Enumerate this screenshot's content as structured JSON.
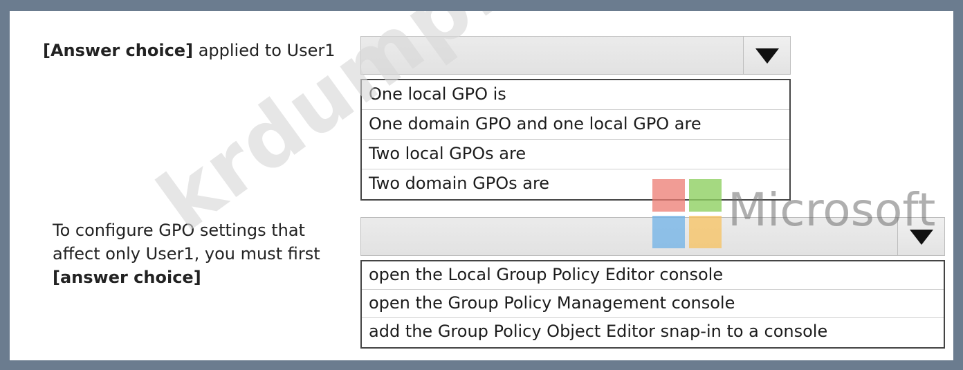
{
  "question_1": {
    "prompt_bold": "[Answer choice]",
    "prompt_rest": " applied to User1",
    "options": [
      "One local GPO is",
      "One domain GPO and one local GPO are",
      "Two local GPOs are",
      "Two domain GPOs are"
    ]
  },
  "question_2": {
    "prompt_before": "To configure GPO settings that affect only User1, you must first ",
    "prompt_bold": "[answer choice]",
    "options": [
      "open the Local Group Policy Editor console",
      "open the Group Policy Management console",
      "add the Group Policy Object Editor snap-in to a console"
    ]
  },
  "overlays": {
    "watermark_text": "krdump.com",
    "logo_text": "Microsoft",
    "logo_colors": [
      "#ec7b72",
      "#8fcf61",
      "#6fb2e7",
      "#f7c25f"
    ]
  },
  "icons": {
    "dropdown_arrow": "triangle-down-icon",
    "logo": "microsoft-logo-icon"
  }
}
